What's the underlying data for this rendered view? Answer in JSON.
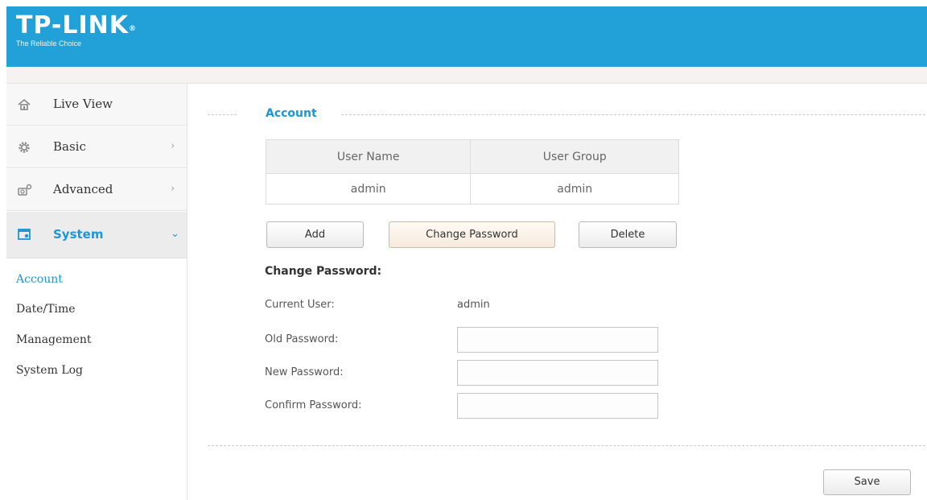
{
  "header": {
    "logo_text": "TP-LINK",
    "logo_tm": "®",
    "tagline": "The Reliable Choice",
    "brand_color": "#22a0d8"
  },
  "sidebar": {
    "items": [
      {
        "label": "Live View",
        "icon": "home-icon",
        "chevron": ""
      },
      {
        "label": "Basic",
        "icon": "gear-icon",
        "chevron": "›"
      },
      {
        "label": "Advanced",
        "icon": "camera-gear-icon",
        "chevron": "›"
      },
      {
        "label": "System",
        "icon": "system-window-icon",
        "chevron": "⌄"
      }
    ],
    "subitems": [
      "Account",
      "Date/Time",
      "Management",
      "System Log"
    ],
    "active_subitem": "Account",
    "accent_color": "#1f95d2"
  },
  "account": {
    "title": "Account",
    "table": {
      "headers": [
        "User Name",
        "User Group"
      ],
      "rows": [
        [
          "admin",
          "admin"
        ]
      ]
    },
    "buttons": {
      "add": "Add",
      "change_password": "Change Password",
      "delete": "Delete"
    },
    "selected_button": "Change Password"
  },
  "change_password": {
    "heading": "Change Password:",
    "current_user_label": "Current User:",
    "current_user_value": "admin",
    "old_password_label": "Old Password:",
    "new_password_label": "New Password:",
    "confirm_password_label": "Confirm Password:",
    "old_password_value": "",
    "new_password_value": "",
    "confirm_password_value": ""
  },
  "footer": {
    "save_label": "Save"
  }
}
